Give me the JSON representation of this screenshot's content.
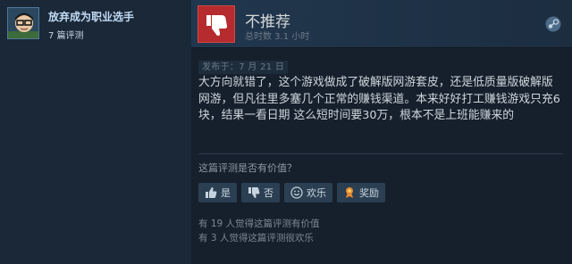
{
  "author": {
    "name": "放弃成为职业选手",
    "review_count": "7 篇评测"
  },
  "review": {
    "verdict": "不推荐",
    "hours": "总时数 3.1 小时",
    "posted": "发布于：7 月 21 日",
    "text": "大方向就错了，这个游戏做成了破解版网游套皮，还是低质量版破解版网游，但凡往里多塞几个正常的赚钱渠道。本来好好打工赚钱游戏只充6块，结果一看日期 这么短时间要30万，根本不是上班能赚来的",
    "helpful_question": "这篇评测是否有价值？",
    "buttons": {
      "yes": "是",
      "no": "否",
      "funny": "欢乐",
      "award": "奖励"
    },
    "helpful_stat": "有 19 人觉得这篇评测有价值",
    "funny_stat": "有 3 人觉得这篇评测很欢乐"
  },
  "colors": {
    "background": "#1b2838",
    "thumb_down_bg": "#b52b2e",
    "author_name": "#c1dbf4"
  },
  "icons": [
    "avatar",
    "thumbs-down-icon",
    "steam-store-icon",
    "thumbs-up-icon",
    "smile-icon",
    "award-icon"
  ]
}
